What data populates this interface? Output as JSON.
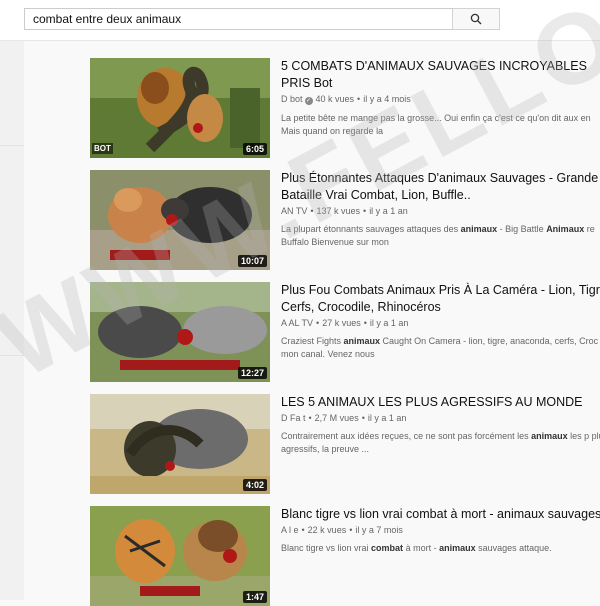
{
  "search": {
    "query": "combat entre deux animaux",
    "button_icon": "search-icon"
  },
  "results": [
    {
      "title": "5 COMBATS D'ANIMAUX SAUVAGES INCROYABLES PRIS Bot",
      "channel": "D   bot",
      "views": "40 k vues",
      "age": "il y a 4 mois",
      "desc_parts": [
        {
          "t": "La petite bête ne mange pas la grosse... Oui enfin ça c'est ce qu'on dit aux en Mais quand on regarde la",
          "b": false
        }
      ],
      "duration": "6:05",
      "badge": "BOT"
    },
    {
      "title": "Plus Étonnantes Attaques D'animaux Sauvages - Grande Bataille Vrai Combat, Lion, Buffle..",
      "channel": "AN      TV",
      "views": "137 k vues",
      "age": "il y a 1 an",
      "desc_parts": [
        {
          "t": "La plupart étonnants sauvages attaques des ",
          "b": false
        },
        {
          "t": "animaux",
          "b": true
        },
        {
          "t": " - Big Battle ",
          "b": false
        },
        {
          "t": "Animaux",
          "b": true
        },
        {
          "t": " re Buffalo Bienvenue sur mon",
          "b": false
        }
      ],
      "duration": "10:07"
    },
    {
      "title": "Plus Fou Combats Animaux Pris À La Caméra - Lion, Tigre, Cerfs, Crocodile, Rhinocéros",
      "channel": "A    AL   TV",
      "views": "27 k vues",
      "age": "il y a 1 an",
      "desc_parts": [
        {
          "t": "Craziest Fights ",
          "b": false
        },
        {
          "t": "animaux",
          "b": true
        },
        {
          "t": " Caught On Camera - lion, tigre, anaconda, cerfs, Croc mon canal. Venez nous",
          "b": false
        }
      ],
      "duration": "12:27"
    },
    {
      "title": "LES 5 ANIMAUX LES PLUS AGRESSIFS AU MONDE",
      "channel": "D    Fa  t",
      "views": "2,7 M vues",
      "age": "il y a 1 an",
      "desc_parts": [
        {
          "t": "Contrairement aux idées reçues, ce ne sont pas forcément les ",
          "b": false
        },
        {
          "t": "animaux",
          "b": true
        },
        {
          "t": " les p plus agressifs, la preuve ...",
          "b": false
        }
      ],
      "duration": "4:02"
    },
    {
      "title": "Blanc tigre vs lion vrai combat à mort - animaux sauvages",
      "channel": "A    l   e",
      "views": "22 k vues",
      "age": "il y a 7 mois",
      "desc_parts": [
        {
          "t": "Blanc tigre vs lion vrai ",
          "b": false
        },
        {
          "t": "combat",
          "b": true
        },
        {
          "t": " à mort - ",
          "b": false
        },
        {
          "t": "animaux",
          "b": true
        },
        {
          "t": " sauvages attaque.",
          "b": false
        }
      ],
      "duration": "1:47"
    }
  ],
  "watermark": "WWW.FELLOTRODZ.COM",
  "colors": {
    "bg": "#f9f9f9",
    "muted": "#666666",
    "duration_bg": "#000000"
  }
}
